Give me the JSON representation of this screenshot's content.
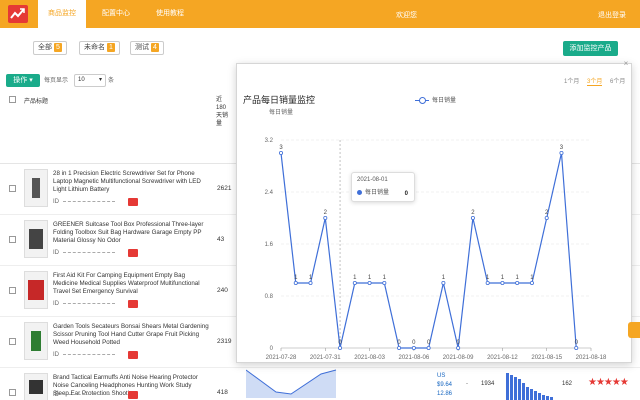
{
  "nav": {
    "tabs": [
      {
        "label": "商品监控",
        "active": true
      },
      {
        "label": "配置中心",
        "active": false
      },
      {
        "label": "使用教程",
        "active": false
      }
    ],
    "welcome": "欢迎您",
    "logout": "退出登录"
  },
  "filters": [
    {
      "label": "全部",
      "count": "5"
    },
    {
      "label": "未命名",
      "count": "1"
    },
    {
      "label": "测试",
      "count": "4"
    }
  ],
  "add_button": "添加监控产品",
  "toolbar": {
    "operate": "操作 ▾",
    "per_page_label": "每页显示",
    "per_page_value": "10",
    "per_page_suffix": "条"
  },
  "table": {
    "col_title": "产品标题",
    "col_sales": "近180天销量",
    "rows": [
      {
        "title": "28 in 1 Precision Electric Screwdriver Set for Phone Laptop Magnetic Multifunctional Screwdriver with LED Light Lithium Battery",
        "id_label": "ID",
        "sales": "2621"
      },
      {
        "title": "GREENER Suitcase Tool Box Professional Three-layer Folding Toolbox Suit Bag Hardware Garage Empty PP Material Glossy No Odor",
        "id_label": "ID",
        "sales": "43"
      },
      {
        "title": "First Aid Kit For Camping Equipment Empty Bag Medicine Medical Supplies Waterproof Multifunctional Travel Set Emergency Survival",
        "id_label": "ID",
        "sales": "240"
      },
      {
        "title": "Garden Tools Secateurs Bonsai Shears Metal Gardening Scissor Pruning Tool Hand Cutter Grape Fruit Picking Weed Household Potted",
        "id_label": "ID",
        "sales": "2319"
      },
      {
        "title": "Brand Tactical Earmuffs Anti Noise Hearing Protector Noise Canceling Headphones Hunting Work Study Sleep Ear Protection Shooting",
        "id_label": "ID",
        "sales": "418",
        "price_cur": "US",
        "price_a": "$9.64",
        "price_b": "12.86",
        "dash": "-",
        "rank": "1934",
        "reviews": "162",
        "stars": "★★★★★"
      }
    ]
  },
  "popup": {
    "title": "产品每日销量监控",
    "ranges": [
      {
        "label": "1个月",
        "active": false
      },
      {
        "label": "3个月",
        "active": true
      },
      {
        "label": "6个月",
        "active": false
      }
    ],
    "close": "×",
    "tooltip": {
      "date": "2021-08-01",
      "series": "每日销量",
      "value": "0"
    }
  },
  "chart_data": {
    "type": "line",
    "title": "产品每日销量监控",
    "ylabel": "每日销量",
    "legend": "每日销量",
    "legend_position": "top",
    "ylim": [
      0,
      3.2
    ],
    "yticks": [
      "0",
      "0.8",
      "1.6",
      "2.4",
      "3.2"
    ],
    "xticks": [
      "2021-07-28",
      "2021-07-31",
      "2021-08-03",
      "2021-08-06",
      "2021-08-09",
      "2021-08-12",
      "2021-08-15",
      "2021-08-18"
    ],
    "series": [
      {
        "name": "每日销量",
        "x": [
          "2021-07-28",
          "2021-07-29",
          "2021-07-30",
          "2021-07-31",
          "2021-08-01",
          "2021-08-02",
          "2021-08-03",
          "2021-08-04",
          "2021-08-05",
          "2021-08-06",
          "2021-08-07",
          "2021-08-08",
          "2021-08-09",
          "2021-08-10",
          "2021-08-11",
          "2021-08-12",
          "2021-08-13",
          "2021-08-14",
          "2021-08-15",
          "2021-08-16",
          "2021-08-17"
        ],
        "values": [
          3,
          1,
          1,
          2,
          0,
          1,
          1,
          1,
          0,
          0,
          0,
          1,
          0,
          2,
          1,
          1,
          1,
          1,
          2,
          3,
          0
        ],
        "color": "#3f6fd8"
      }
    ],
    "crosshair_date": "2021-08-01",
    "grid": "horizontal-dashed"
  }
}
